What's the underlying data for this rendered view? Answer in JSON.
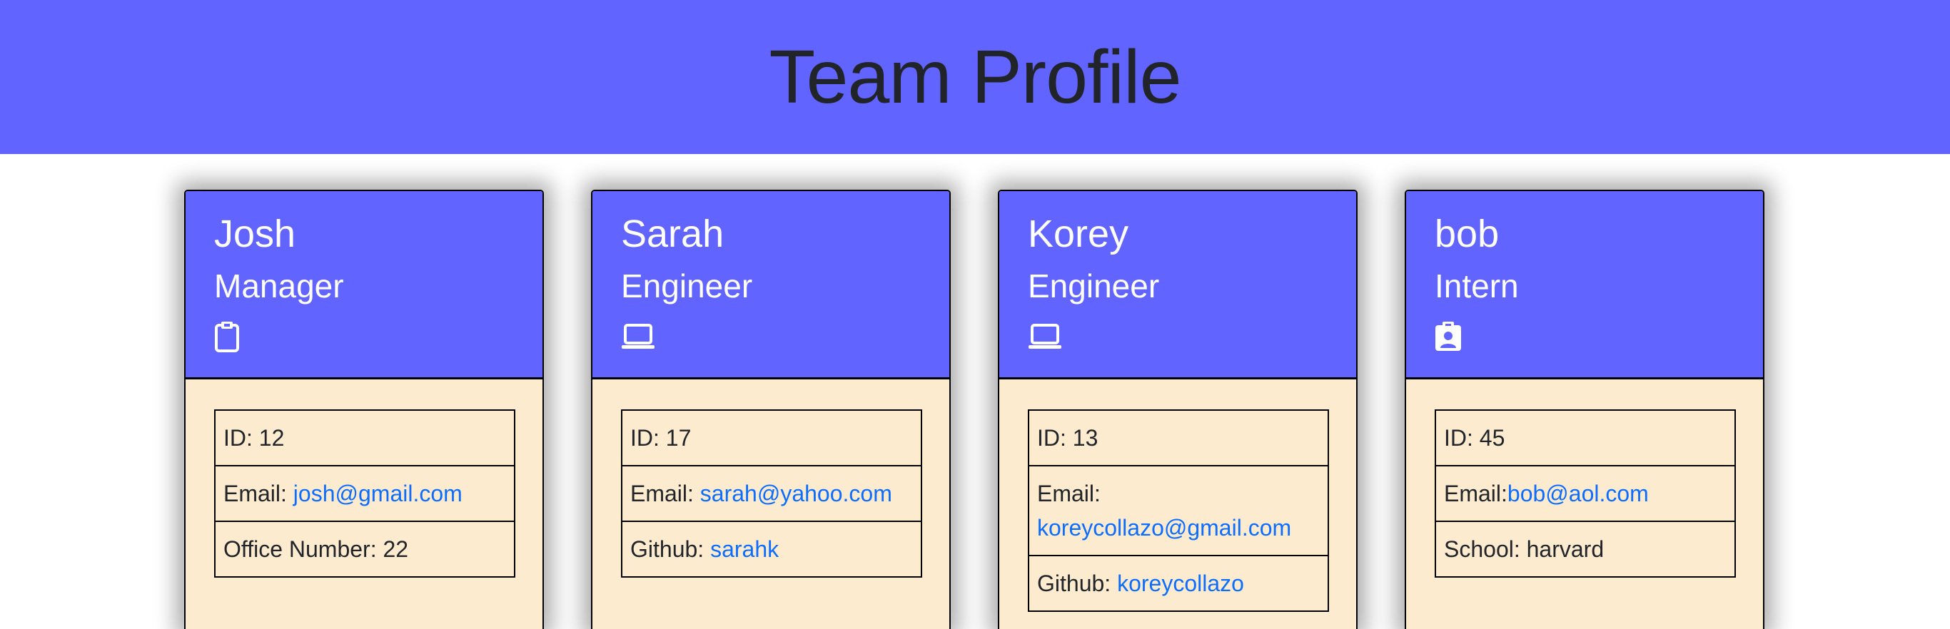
{
  "header": {
    "title": "Team Profile"
  },
  "colors": {
    "header_bg": "#6264ff",
    "card_body_bg": "#fdebcf",
    "link": "#0d6efd"
  },
  "cards": [
    {
      "name": "Josh",
      "role": "Manager",
      "icon": "clipboard-icon",
      "id_text": "ID: 12",
      "email_label": "Email: ",
      "email": "josh@gmail.com",
      "extra_label": "Office Number: 22",
      "extra_link": ""
    },
    {
      "name": "Sarah",
      "role": "Engineer",
      "icon": "laptop-icon",
      "id_text": "ID: 17",
      "email_label": "Email: ",
      "email": "sarah@yahoo.com",
      "extra_label": "Github: ",
      "extra_link": "sarahk"
    },
    {
      "name": "Korey",
      "role": "Engineer",
      "icon": "laptop-icon",
      "id_text": "ID: 13",
      "email_label": "Email: ",
      "email": "koreycollazo@gmail.com",
      "extra_label": "Github: ",
      "extra_link": "koreycollazo"
    },
    {
      "name": "bob",
      "role": "Intern",
      "icon": "person-badge-icon",
      "id_text": "ID: 45",
      "email_label": "Email:",
      "email": "bob@aol.com",
      "extra_label": "School: harvard",
      "extra_link": ""
    }
  ]
}
